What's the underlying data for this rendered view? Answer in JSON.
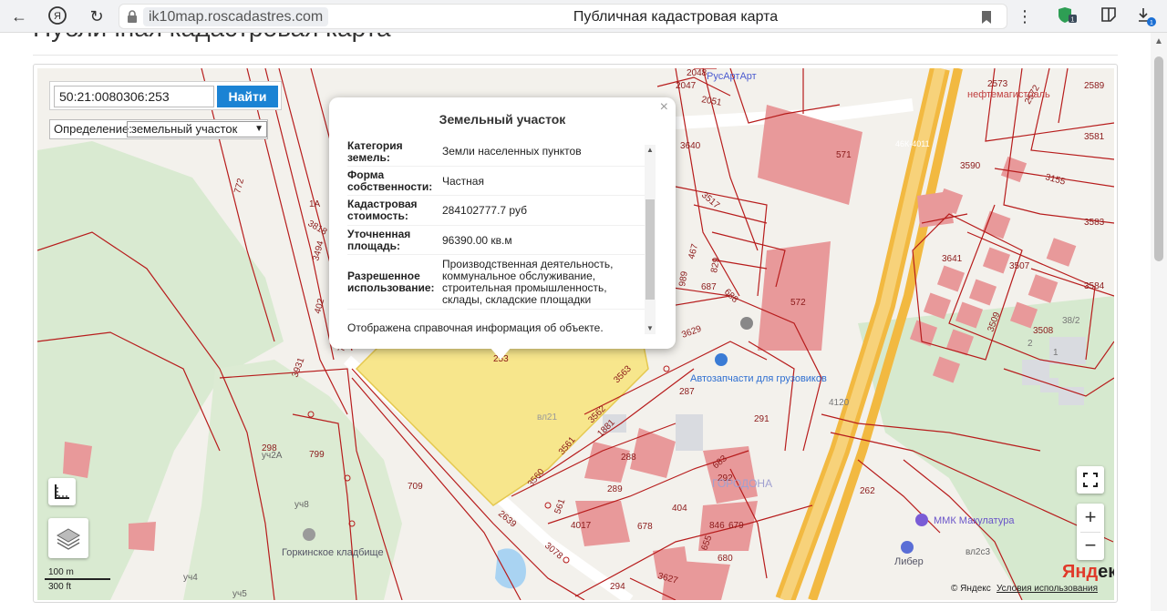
{
  "browser": {
    "domain": "ik10map.roscadastres.com",
    "tab_title": "Публичная кадастровая карта",
    "badge_count": "1"
  },
  "page": {
    "heading": "Публичная кадастровая карта"
  },
  "search": {
    "value": "50:21:0080306:253",
    "button_label": "Найти"
  },
  "definition": {
    "label": "Определение:",
    "selected": "земельный участок"
  },
  "popup": {
    "title": "Земельный участок",
    "rows": [
      {
        "key": "Категория земель:",
        "value": "Земли населенных пунктов"
      },
      {
        "key": "Форма собственности:",
        "value": "Частная"
      },
      {
        "key": "Кадастровая стоимость:",
        "value": "284102777.7 руб"
      },
      {
        "key": "Уточненная площадь:",
        "value": "96390.00 кв.м"
      },
      {
        "key": "Разрешенное использование:",
        "value": "Производственная деятельность, коммунальное обслуживание, строительная промышленность, склады, складские площадки"
      }
    ],
    "note": "Отображена справочная информация об объекте.",
    "close": "×"
  },
  "map": {
    "parcel_labels": [
      "2048",
      "2047",
      "2051",
      "3640",
      "571",
      "46К-4011",
      "2573",
      "2572",
      "2589",
      "3581",
      "3590",
      "3155",
      "3583",
      "3517",
      "467",
      "829",
      "989",
      "687",
      "688",
      "572",
      "3641",
      "3507",
      "3584",
      "3509",
      "3508",
      "38/2",
      "2",
      "1",
      "3629",
      "3563",
      "287",
      "291",
      "4120",
      "3562",
      "1881",
      "288",
      "3561",
      "289",
      "3560",
      "561",
      "4017",
      "2639",
      "3078",
      "683",
      "292",
      "404",
      "846",
      "679",
      "678",
      "680",
      "655",
      "3627",
      "294",
      "262",
      "709",
      "799",
      "298",
      "3931",
      "704",
      "402",
      "3494",
      "3818",
      "772",
      "1А",
      "253",
      "вл21",
      "вл2с3",
      "уч2А",
      "уч8",
      "уч4",
      "уч5"
    ],
    "place_labels": {
      "autoparts": "Автозапчасти для грузовиков",
      "cemetery": "Горкинское кладбище",
      "mmk": "ММК Макулатура",
      "liber": "Либер",
      "artist": "РусАртАрт",
      "neft": "нефтемагистраль",
      "gorodona": "ГОРОДОНА"
    },
    "scale_m": "100 m",
    "scale_ft": "300 ft",
    "copyright": "© Яндекс",
    "terms": "Условия использования",
    "logo_a": "Янд",
    "logo_b": "екс"
  },
  "controls": {
    "zoom_in": "+",
    "zoom_out": "−"
  },
  "colors": {
    "accent": "#1b83d4",
    "parcel_line": "#b71c1c",
    "selected_parcel": "#f7e68c",
    "building": "#e07a7a",
    "green": "#d6e9cf"
  }
}
